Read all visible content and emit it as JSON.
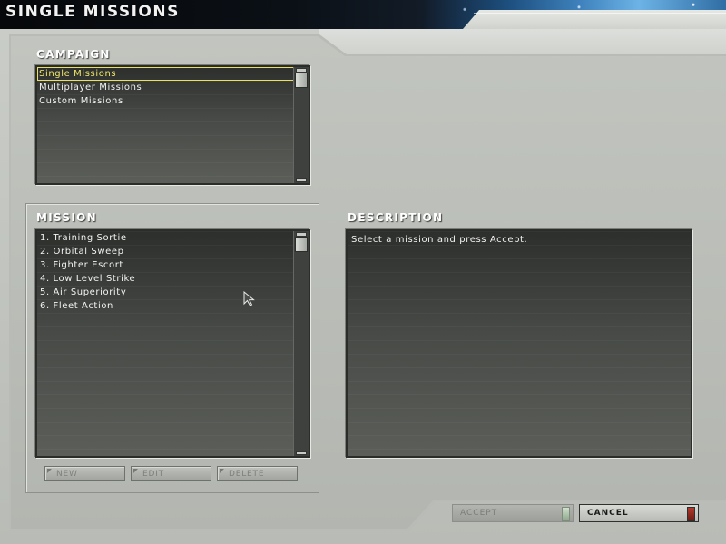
{
  "header": {
    "title": "SINGLE MISSIONS"
  },
  "campaign": {
    "label": "CAMPAIGN",
    "items": [
      "Single Missions",
      "Multiplayer Missions",
      "Custom Missions"
    ],
    "selected": "Single Missions"
  },
  "mission": {
    "label": "MISSION",
    "items": [
      "1. Training Sortie",
      "2. Orbital Sweep",
      "3. Fighter Escort",
      "4. Low Level Strike",
      "5. Air Superiority",
      "6. Fleet Action"
    ],
    "buttons": {
      "new": "NEW",
      "edit": "EDIT",
      "delete": "DELETE"
    }
  },
  "description": {
    "label": "DESCRIPTION",
    "text": "Select a mission and press Accept."
  },
  "footer": {
    "accept": "ACCEPT",
    "cancel": "CANCEL"
  },
  "colors": {
    "panel": "#b9bcb6",
    "list_bg": "#3a3c39",
    "selection": "#f0e76b",
    "cancel_led": "#9a2a20",
    "accept_led": "#a9c1a6"
  },
  "icons": [
    "arrow-pointer-icon",
    "scroll-up-icon",
    "scroll-down-icon"
  ]
}
